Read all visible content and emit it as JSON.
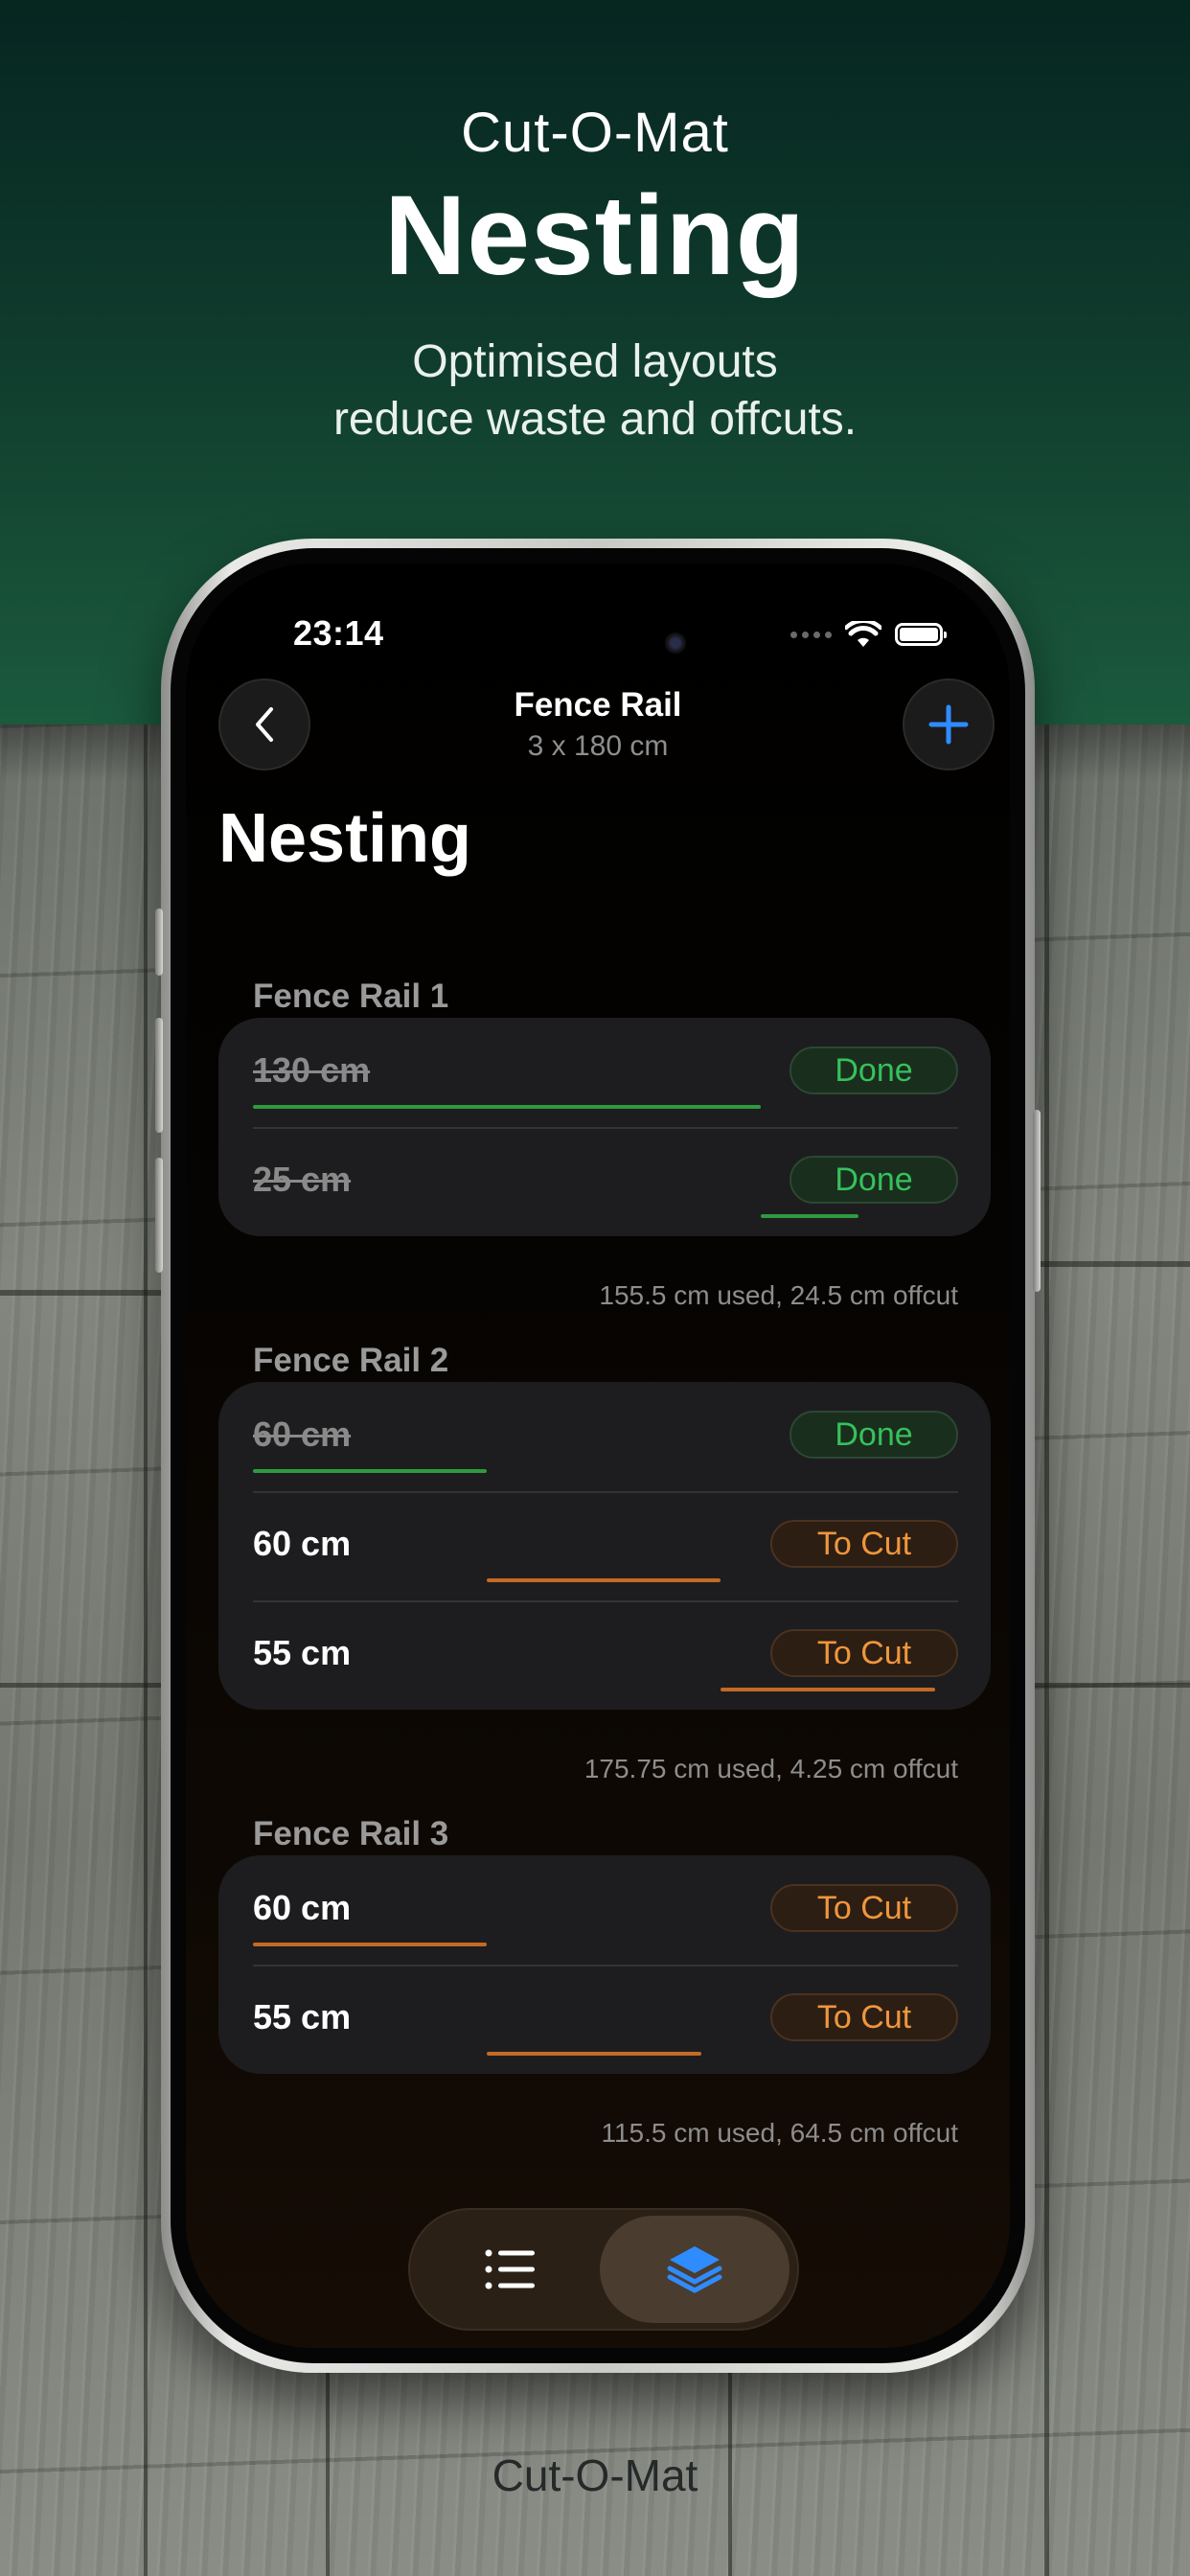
{
  "hero": {
    "app_name": "Cut-O-Mat",
    "headline": "Nesting",
    "tagline_line1": "Optimised layouts",
    "tagline_line2": "reduce waste and offcuts."
  },
  "status_bar": {
    "time": "23:14"
  },
  "nav": {
    "title": "Fence Rail",
    "subtitle": "3 x 180 cm",
    "back_icon": "chevron-left-icon",
    "add_icon": "plus-icon"
  },
  "page_title": "Nesting",
  "rails": [
    {
      "name": "Fence Rail 1",
      "pieces": [
        {
          "length": "130 cm",
          "status": "Done",
          "state": "done"
        },
        {
          "length": "25 cm",
          "status": "Done",
          "state": "done"
        }
      ],
      "summary": "155.5 cm used, 24.5 cm offcut"
    },
    {
      "name": "Fence Rail 2",
      "pieces": [
        {
          "length": "60 cm",
          "status": "Done",
          "state": "done"
        },
        {
          "length": "60 cm",
          "status": "To Cut",
          "state": "tocut"
        },
        {
          "length": "55 cm",
          "status": "To Cut",
          "state": "tocut"
        }
      ],
      "summary": "175.75 cm used, 4.25 cm offcut"
    },
    {
      "name": "Fence Rail 3",
      "pieces": [
        {
          "length": "60 cm",
          "status": "To Cut",
          "state": "tocut"
        },
        {
          "length": "55 cm",
          "status": "To Cut",
          "state": "tocut"
        }
      ],
      "summary": "115.5 cm used, 64.5 cm offcut"
    }
  ],
  "tabbar": {
    "tabs": [
      {
        "icon": "list-icon",
        "selected": false
      },
      {
        "icon": "layers-icon",
        "selected": true
      }
    ]
  },
  "footer": {
    "logo": "Cut-O-Mat"
  },
  "colors": {
    "done_green": "#36c15b",
    "tocut_orange": "#f0963c",
    "accent_blue": "#2f8cff"
  }
}
